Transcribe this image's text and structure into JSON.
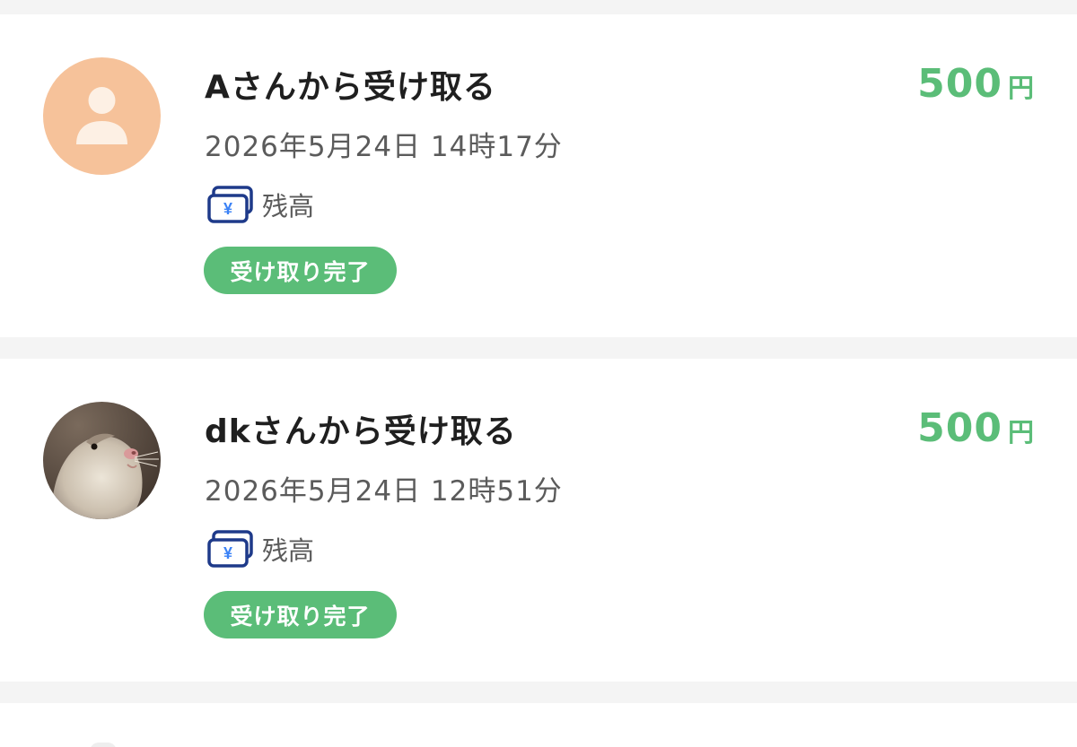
{
  "colors": {
    "accent_green": "#5bbd78",
    "separator": "#f4f4f4",
    "card_bg": "#ffffff",
    "avatar_peach": "#f6c29a",
    "wallet_navy": "#1e3a8a"
  },
  "transactions": [
    {
      "avatar": "default-person-icon",
      "title": "Aさんから受け取る",
      "datetime": "2026年5月24日 14時17分",
      "method_icon": "balance-wallet-icon",
      "method_label": "残高",
      "status": "受け取り完了",
      "amount": "500",
      "currency": "円"
    },
    {
      "avatar": "hamster-photo",
      "title": "dkさんから受け取る",
      "datetime": "2026年5月24日 12時51分",
      "method_icon": "balance-wallet-icon",
      "method_label": "残高",
      "status": "受け取り完了",
      "amount": "500",
      "currency": "円"
    }
  ]
}
